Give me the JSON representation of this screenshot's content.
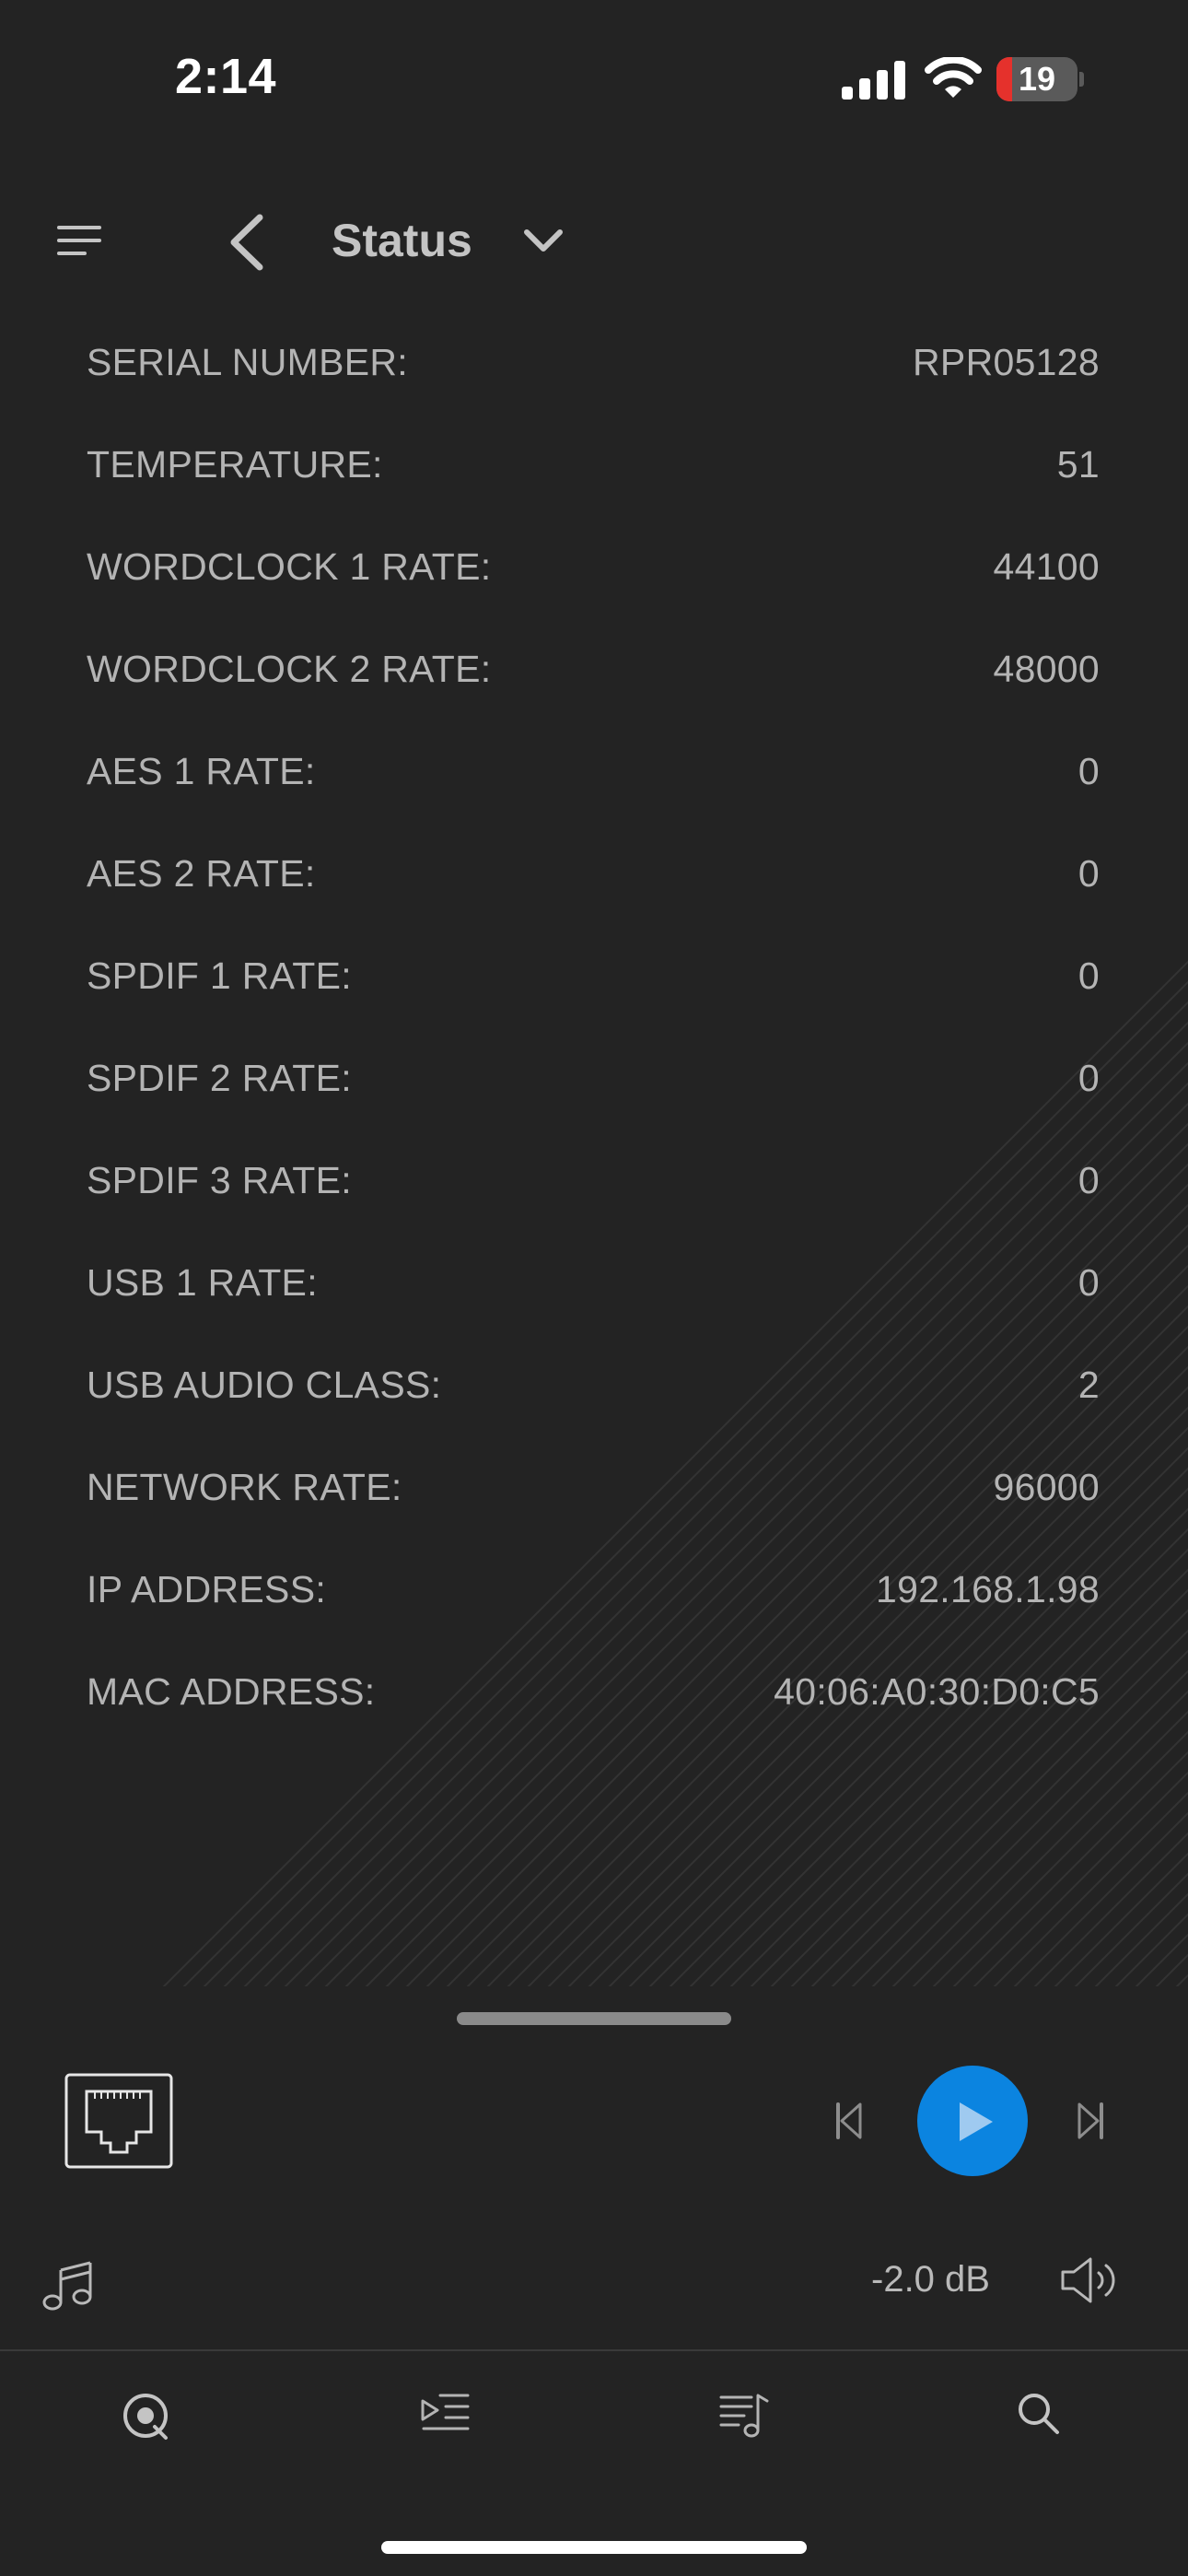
{
  "status_bar": {
    "time": "2:14",
    "battery_level": "19",
    "battery_fraction": 0.19,
    "battery_color": "#e5312c"
  },
  "header": {
    "title": "Status",
    "menu_icon": "hamburger-menu-icon",
    "back_icon": "chevron-left-icon",
    "dropdown_icon": "chevron-down-icon"
  },
  "status_rows": [
    {
      "label": "SERIAL NUMBER:",
      "value": "RPR05128"
    },
    {
      "label": "TEMPERATURE:",
      "value": "51"
    },
    {
      "label": "WORDCLOCK 1 RATE:",
      "value": "44100"
    },
    {
      "label": "WORDCLOCK 2 RATE:",
      "value": "48000"
    },
    {
      "label": "AES 1 RATE:",
      "value": "0"
    },
    {
      "label": "AES 2 RATE:",
      "value": "0"
    },
    {
      "label": "SPDIF 1 RATE:",
      "value": "0"
    },
    {
      "label": "SPDIF 2 RATE:",
      "value": "0"
    },
    {
      "label": "SPDIF 3 RATE:",
      "value": "0"
    },
    {
      "label": "USB 1 RATE:",
      "value": "0"
    },
    {
      "label": "USB AUDIO CLASS:",
      "value": "2"
    },
    {
      "label": "NETWORK RATE:",
      "value": "96000"
    },
    {
      "label": "IP ADDRESS:",
      "value": "192.168.1.98"
    },
    {
      "label": "MAC ADDRESS:",
      "value": "40:06:A0:30:D0:C5"
    }
  ],
  "player": {
    "source_icon": "ethernet-port-icon",
    "volume": "-2.0 dB",
    "accent_color": "#0b84e0"
  },
  "tabs": [
    {
      "name": "now-playing",
      "icon": "disc-icon"
    },
    {
      "name": "queue",
      "icon": "play-queue-icon"
    },
    {
      "name": "playlists",
      "icon": "playlist-music-icon"
    },
    {
      "name": "search",
      "icon": "search-icon"
    }
  ]
}
